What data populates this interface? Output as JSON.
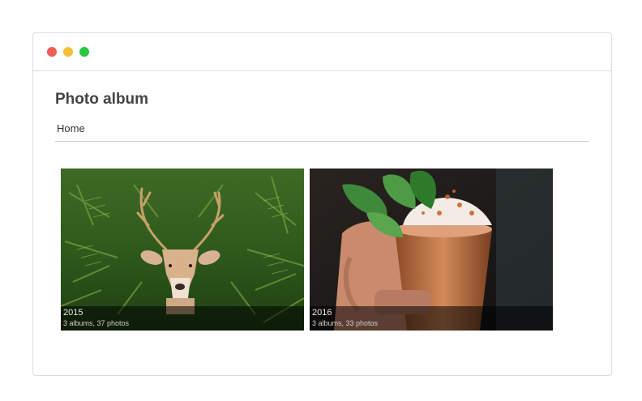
{
  "page": {
    "title": "Photo album"
  },
  "breadcrumb": {
    "home_label": "Home"
  },
  "albums": [
    {
      "year": "2015",
      "meta": "3 albums, 37 photos",
      "image": "deer-in-ferns"
    },
    {
      "year": "2016",
      "meta": "3 albums, 33 photos",
      "image": "copper-mug-cocktail-with-mint"
    }
  ],
  "colors": {
    "close": "#f05b54",
    "minimize": "#f6be35",
    "maximize": "#27c840",
    "title_text": "#444444"
  }
}
